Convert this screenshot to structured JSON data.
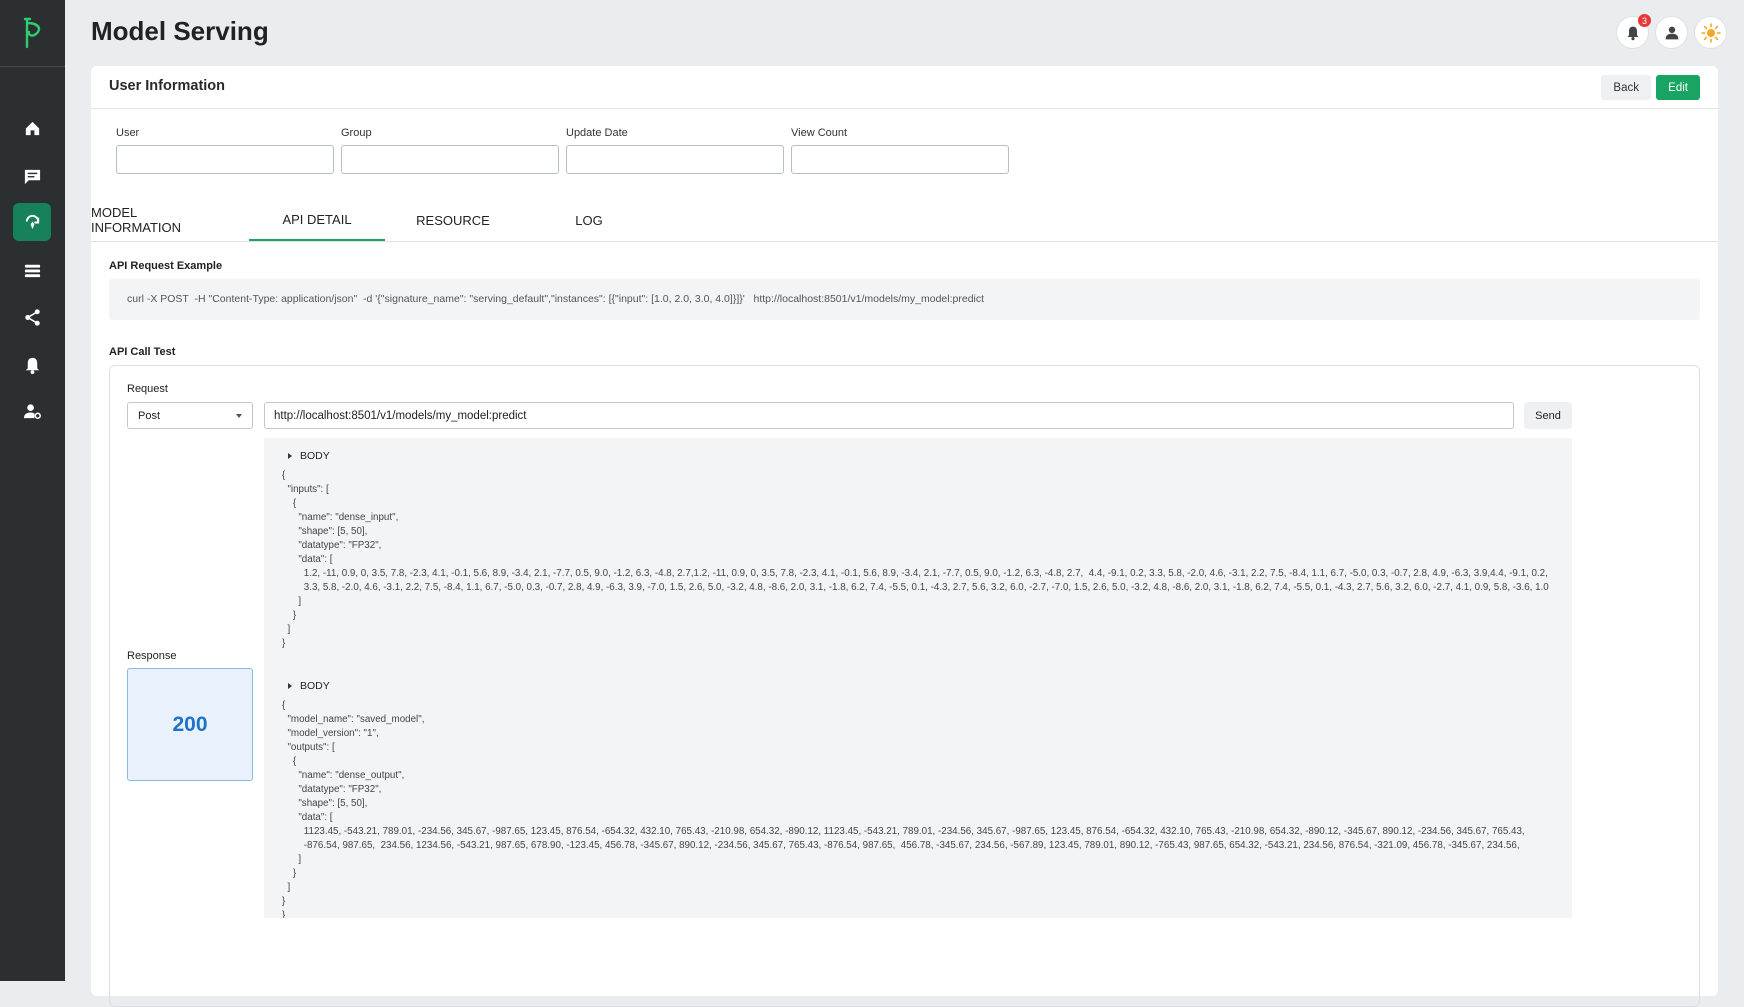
{
  "header": {
    "title": "Model Serving",
    "notification_count": "3"
  },
  "card": {
    "title": "User Information",
    "back_label": "Back",
    "edit_label": "Edit",
    "fields": [
      {
        "label": "User",
        "value": ""
      },
      {
        "label": "Group",
        "value": ""
      },
      {
        "label": "Update Date",
        "value": ""
      },
      {
        "label": "View Count",
        "value": ""
      }
    ],
    "tabs": [
      {
        "label": "MODEL INFORMATION",
        "active": false
      },
      {
        "label": "API DETAIL",
        "active": true
      },
      {
        "label": "RESOURCE",
        "active": false
      },
      {
        "label": "LOG",
        "active": false
      }
    ]
  },
  "api": {
    "example_label": "API Request Example",
    "example_command": "curl -X POST  -H \"Content-Type: application/json\"  -d '{\"signature_name\": \"serving_default\",\"instances\": [{\"input\": [1.0, 2.0, 3.0, 4.0]}]}'   http://localhost:8501/v1/models/my_model:predict",
    "call_test_label": "API Call Test",
    "request_label": "Request",
    "method": "Post",
    "url": "http://localhost:8501/v1/models/my_model:predict",
    "send_label": "Send",
    "request_body_toggle": "BODY",
    "request_body": "{\n  \"inputs\": [\n    {\n      \"name\": \"dense_input\",\n      \"shape\": [5, 50],\n      \"datatype\": \"FP32\",\n      \"data\": [\n        1.2, -11, 0.9, 0, 3.5, 7.8, -2.3, 4.1, -0.1, 5.6, 8.9, -3.4, 2.1, -7.7, 0.5, 9.0, -1.2, 6.3, -4.8, 2.7,1.2, -11, 0.9, 0, 3.5, 7.8, -2.3, 4.1, -0.1, 5.6, 8.9, -3.4, 2.1, -7.7, 0.5, 9.0, -1.2, 6.3, -4.8, 2.7,  4.4, -9.1, 0.2, 3.3, 5.8, -2.0, 4.6, -3.1, 2.2, 7.5, -8.4, 1.1, 6.7, -5.0, 0.3, -0.7, 2.8, 4.9, -6.3, 3.9,4.4, -9.1, 0.2,\n        3.3, 5.8, -2.0, 4.6, -3.1, 2.2, 7.5, -8.4, 1.1, 6.7, -5.0, 0.3, -0.7, 2.8, 4.9, -6.3, 3.9, -7.0, 1.5, 2.6, 5.0, -3.2, 4.8, -8.6, 2.0, 3.1, -1.8, 6.2, 7.4, -5.5, 0.1, -4.3, 2.7, 5.6, 3.2, 6.0, -2.7, -7.0, 1.5, 2.6, 5.0, -3.2, 4.8, -8.6, 2.0, 3.1, -1.8, 6.2, 7.4, -5.5, 0.1, -4.3, 2.7, 5.6, 3.2, 6.0, -2.7, 4.1, 0.9, 5.8, -3.6, 1.0\n      ]\n    }\n  ]\n}",
    "response_label": "Response",
    "status_code": "200",
    "response_body_toggle": "BODY",
    "response_body": "{\n  \"model_name\": \"saved_model\",\n  \"model_version\": \"1\",\n  \"outputs\": [\n    {\n      \"name\": \"dense_output\",\n      \"datatype\": \"FP32\",\n      \"shape\": [5, 50],\n      \"data\": [\n        1123.45, -543.21, 789.01, -234.56, 345.67, -987.65, 123.45, 876.54, -654.32, 432.10, 765.43, -210.98, 654.32, -890.12, 1123.45, -543.21, 789.01, -234.56, 345.67, -987.65, 123.45, 876.54, -654.32, 432.10, 765.43, -210.98, 654.32, -890.12, -345.67, 890.12, -234.56, 345.67, 765.43,\n        -876.54, 987.65,  234.56, 1234.56, -543.21, 987.65, 678.90, -123.45, 456.78, -345.67, 890.12, -234.56, 345.67, 765.43, -876.54, 987.65,  456.78, -345.67, 234.56, -567.89, 123.45, 789.01, 890.12, -765.43, 987.65, 654.32, -543.21, 234.56, 876.54, -321.09, 456.78, -345.67, 234.56,\n      ]\n    }\n  ]\n}\n}"
  },
  "sidebar": {
    "items": [
      {
        "icon": "home-icon",
        "active": false
      },
      {
        "icon": "message-icon",
        "active": false
      },
      {
        "icon": "model-serving-icon",
        "active": true
      },
      {
        "icon": "list-icon",
        "active": false
      },
      {
        "icon": "share-icon",
        "active": false
      },
      {
        "icon": "bell-icon",
        "active": false
      },
      {
        "icon": "user-settings-icon",
        "active": false
      }
    ]
  },
  "colors": {
    "accent": "#19a463",
    "sidebar": "#2b2f31",
    "status": "#1e72c8"
  }
}
